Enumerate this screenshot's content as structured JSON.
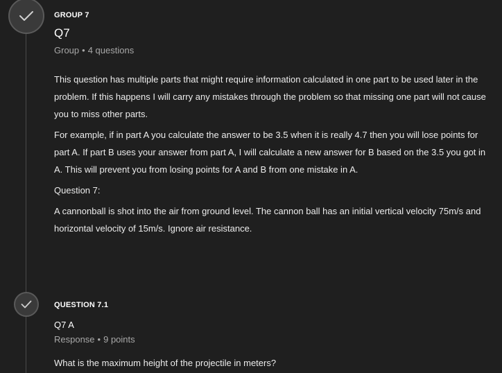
{
  "group": {
    "eyebrow": "GROUP 7",
    "title": "Q7",
    "meta_type": "Group",
    "meta_detail": "4 questions",
    "paragraphs": [
      "This question has multiple parts that might require information calculated in one part to be used later in the problem. If this happens I will carry any mistakes through the problem so that missing one part will not cause you to miss other parts.",
      "For example, if in part A you calculate the answer to be 3.5 when it is really 4.7 then you will lose points for part A. If part B uses your answer from part A, I will calculate a new answer for B based on the 3.5 you got in A. This will prevent you from losing points for A and B from one mistake in A.",
      "Question 7:",
      "A cannonball is shot into the air from ground level. The cannon ball has an initial vertical velocity 75m/s and horizontal velocity of 15m/s. Ignore air resistance."
    ],
    "status_icon": "check-icon"
  },
  "question": {
    "eyebrow": "QUESTION 7.1",
    "title": "Q7 A",
    "meta_type": "Response",
    "meta_detail": "9 points",
    "prompt": "What is the maximum height of the projectile in meters?",
    "status_icon": "check-icon"
  },
  "meta_separator": "•",
  "colors": {
    "background": "#1f1f1f",
    "circle_fill": "#3a3a3a",
    "circle_border": "#5a5a5a",
    "timeline": "#4a4a4a",
    "muted_text": "#a8a8a8",
    "text": "#ececec"
  }
}
